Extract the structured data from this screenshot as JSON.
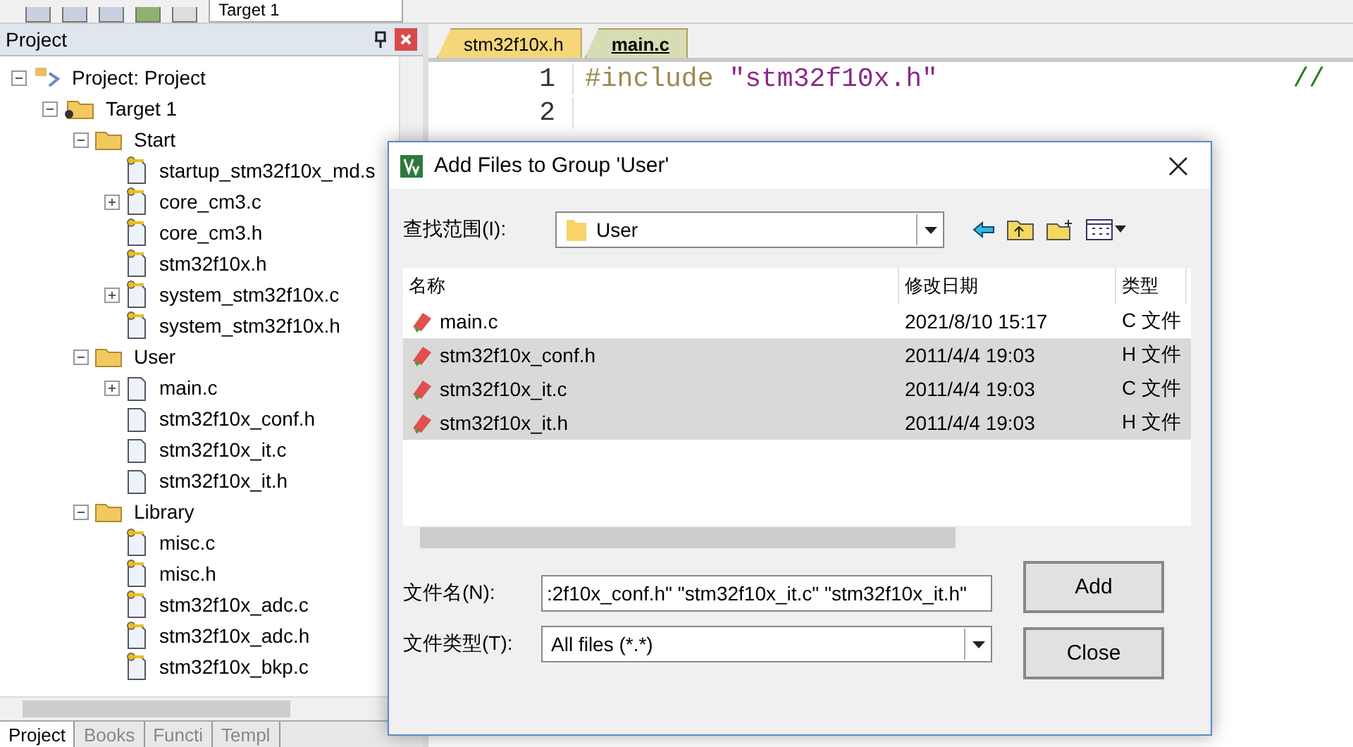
{
  "toolbar": {
    "target": "Target 1"
  },
  "project_panel": {
    "title": "Project",
    "tree": [
      {
        "label": "Project: Project",
        "kind": "project",
        "expanded": true,
        "children": [
          {
            "label": "Target 1",
            "kind": "target",
            "expanded": true,
            "children": [
              {
                "label": "Start",
                "kind": "folder",
                "expanded": true,
                "children": [
                  {
                    "label": "startup_stm32f10x_md.s",
                    "kind": "locked"
                  },
                  {
                    "label": "core_cm3.c",
                    "kind": "locked",
                    "expanded": false
                  },
                  {
                    "label": "core_cm3.h",
                    "kind": "locked"
                  },
                  {
                    "label": "stm32f10x.h",
                    "kind": "locked"
                  },
                  {
                    "label": "system_stm32f10x.c",
                    "kind": "locked",
                    "expanded": false
                  },
                  {
                    "label": "system_stm32f10x.h",
                    "kind": "locked"
                  }
                ]
              },
              {
                "label": "User",
                "kind": "folder",
                "expanded": true,
                "children": [
                  {
                    "label": "main.c",
                    "kind": "plain",
                    "expanded": false
                  },
                  {
                    "label": "stm32f10x_conf.h",
                    "kind": "plain"
                  },
                  {
                    "label": "stm32f10x_it.c",
                    "kind": "plain"
                  },
                  {
                    "label": "stm32f10x_it.h",
                    "kind": "plain"
                  }
                ]
              },
              {
                "label": "Library",
                "kind": "folder",
                "expanded": true,
                "children": [
                  {
                    "label": "misc.c",
                    "kind": "locked"
                  },
                  {
                    "label": "misc.h",
                    "kind": "locked"
                  },
                  {
                    "label": "stm32f10x_adc.c",
                    "kind": "locked"
                  },
                  {
                    "label": "stm32f10x_adc.h",
                    "kind": "locked"
                  },
                  {
                    "label": "stm32f10x_bkp.c",
                    "kind": "locked"
                  }
                ]
              }
            ]
          }
        ]
      }
    ],
    "bottom_tabs": [
      {
        "label": "Project",
        "selected": true
      },
      {
        "label": "Books",
        "selected": false
      },
      {
        "label": "Functi",
        "selected": false
      },
      {
        "label": "Templ",
        "selected": false
      }
    ]
  },
  "editor": {
    "tabs": [
      {
        "label": "stm32f10x.h",
        "selected": false,
        "color": "#f5d77a"
      },
      {
        "label": "main.c",
        "selected": true,
        "color": "#d8dcb4"
      }
    ],
    "lines": [
      {
        "number": "1",
        "directive": "#include",
        "string": "\"stm32f10x.h\"",
        "comment": "//"
      },
      {
        "number": "2"
      }
    ]
  },
  "dialog": {
    "title": "Add Files to Group 'User'",
    "look_in_label": "查找范围(I):",
    "look_in_value": "User",
    "columns": [
      "名称",
      "修改日期",
      "类型"
    ],
    "files": [
      {
        "name": "main.c",
        "modified": "2021/8/10 15:17",
        "type": "C 文件",
        "selected": false
      },
      {
        "name": "stm32f10x_conf.h",
        "modified": "2011/4/4 19:03",
        "type": "H 文件",
        "selected": true
      },
      {
        "name": "stm32f10x_it.c",
        "modified": "2011/4/4 19:03",
        "type": "C 文件",
        "selected": true
      },
      {
        "name": "stm32f10x_it.h",
        "modified": "2011/4/4 19:03",
        "type": "H 文件",
        "selected": true
      }
    ],
    "file_name_label": "文件名(N):",
    "file_name_value": ":2f10x_conf.h\" \"stm32f10x_it.c\" \"stm32f10x_it.h\"",
    "file_type_label": "文件类型(T):",
    "file_type_value": "All files (*.*)",
    "buttons": [
      "Add",
      "Close"
    ]
  }
}
